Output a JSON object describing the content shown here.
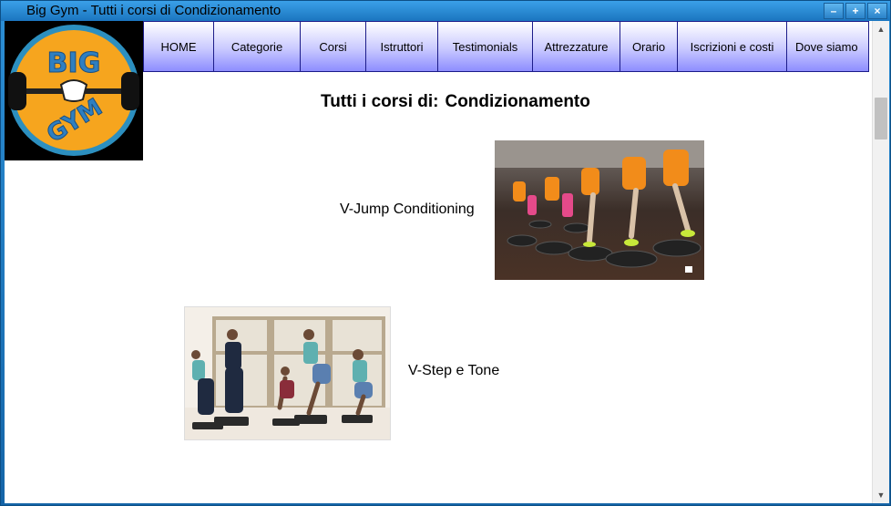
{
  "window": {
    "title": "Big Gym - Tutti i corsi di Condizionamento",
    "controls": {
      "minimize": "–",
      "maximize": "+",
      "close": "×"
    }
  },
  "logo": {
    "top_text": "BIG",
    "bottom_text": "GYM"
  },
  "nav": {
    "items": [
      {
        "label": "HOME"
      },
      {
        "label": "Categorie"
      },
      {
        "label": "Corsi"
      },
      {
        "label": "Istruttori"
      },
      {
        "label": "Testimonials"
      },
      {
        "label": "Attrezzature"
      },
      {
        "label": "Orario"
      },
      {
        "label": "Iscrizioni e costi"
      },
      {
        "label": "Dove siamo"
      }
    ]
  },
  "heading": {
    "prefix": "Tutti i corsi di:",
    "category": "Condizionamento"
  },
  "courses": [
    {
      "name": "V-Jump Conditioning"
    },
    {
      "name": "V-Step e Tone"
    }
  ],
  "colors": {
    "titlebar": "#2a8ad3",
    "nav_gradient_bottom": "#8d8dff",
    "nav_border": "#1c1c8a",
    "logo_orange": "#f6a51e",
    "logo_blue": "#2f7fc0"
  },
  "icons": {
    "scroll_up": "▲",
    "scroll_down": "▼"
  }
}
